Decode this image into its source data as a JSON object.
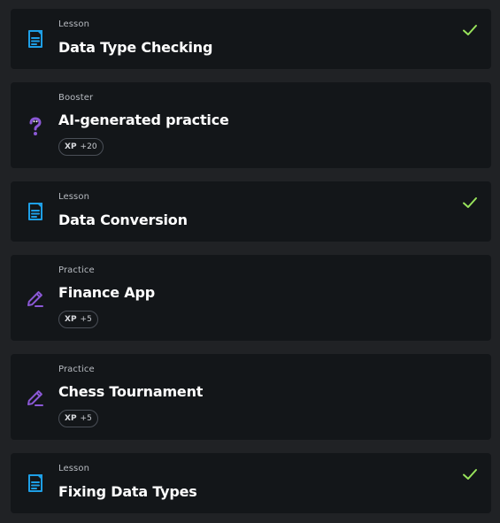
{
  "colors": {
    "page_background": "#202225",
    "card_background": "#131619",
    "lesson_icon": "#1e9fe6",
    "practice_icon": "#8b58d6",
    "booster_icon": "#8b58d6",
    "check": "#98e35b"
  },
  "items": [
    {
      "type_label": "Lesson",
      "title": "Data Type Checking",
      "icon": "document-icon",
      "completed": true
    },
    {
      "type_label": "Booster",
      "title": "AI-generated practice",
      "icon": "question-mark-icon",
      "xp_label": "XP",
      "xp_value": "+20",
      "completed": false
    },
    {
      "type_label": "Lesson",
      "title": "Data Conversion",
      "icon": "document-icon",
      "completed": true
    },
    {
      "type_label": "Practice",
      "title": "Finance App",
      "icon": "pencil-icon",
      "xp_label": "XP",
      "xp_value": "+5",
      "completed": false
    },
    {
      "type_label": "Practice",
      "title": "Chess Tournament",
      "icon": "pencil-icon",
      "xp_label": "XP",
      "xp_value": "+5",
      "completed": false
    },
    {
      "type_label": "Lesson",
      "title": "Fixing Data Types",
      "icon": "document-icon",
      "completed": true
    }
  ]
}
